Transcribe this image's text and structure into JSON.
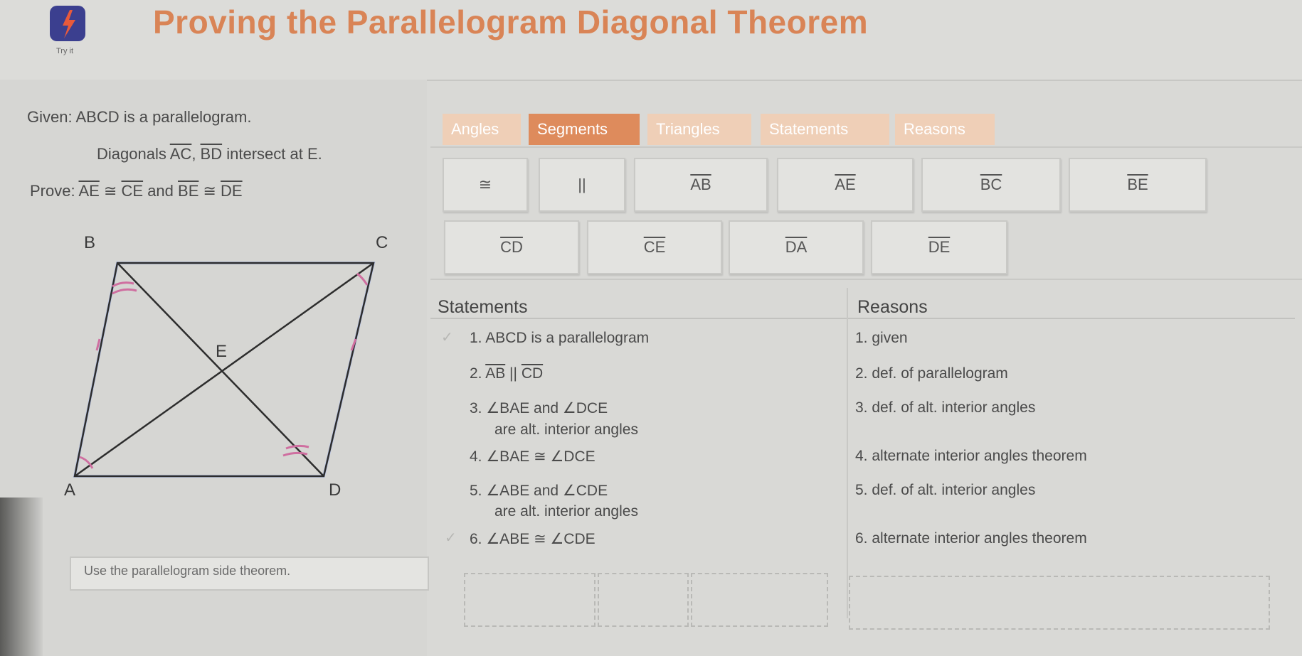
{
  "header": {
    "title": "Proving the Parallelogram Diagonal Theorem",
    "try_it": "Try it"
  },
  "given": {
    "line1": "Given: ABCD is a parallelogram.",
    "line2_prefix": "Diagonals ",
    "seg_ac": "AC",
    "comma": ", ",
    "seg_bd": "BD",
    "line2_suffix": " intersect at E.",
    "prove_prefix": "Prove: ",
    "seg_ae": "AE",
    "cong1": " ≅ ",
    "seg_ce": "CE",
    "and": " and ",
    "seg_be": "BE",
    "cong2": " ≅ ",
    "seg_de": "DE"
  },
  "diagram": {
    "labels": {
      "a": "A",
      "b": "B",
      "c": "C",
      "d": "D",
      "e": "E"
    }
  },
  "tabs": [
    "Angles",
    "Segments",
    "Triangles",
    "Statements",
    "Reasons"
  ],
  "active_tab": "Segments",
  "tiles": [
    "≅",
    "||",
    "AB",
    "AE",
    "BC",
    "BE",
    "CD",
    "CE",
    "DA",
    "DE"
  ],
  "proof": {
    "statements_header": "Statements",
    "reasons_header": "Reasons",
    "rows": [
      {
        "num": "1.",
        "statement": "ABCD is a parallelogram",
        "reason": "1. given"
      },
      {
        "num": "2.",
        "seg1": "AB",
        "sym": " || ",
        "seg2": "CD",
        "reason": "2. def. of parallelogram"
      },
      {
        "num": "3.",
        "statement": "∠BAE and ∠DCE",
        "statement2": "are alt. interior angles",
        "reason": "3. def. of alt. interior angles"
      },
      {
        "num": "4.",
        "statement": "∠BAE ≅ ∠DCE",
        "reason": "4. alternate interior angles theorem"
      },
      {
        "num": "5.",
        "statement": "∠ABE and ∠CDE",
        "statement2": "are alt. interior angles",
        "reason": "5. def. of alt. interior angles"
      },
      {
        "num": "6.",
        "statement": "∠ABE ≅ ∠CDE",
        "reason": "6. alternate interior angles theorem"
      }
    ]
  },
  "hint": "Use the parallelogram side theorem."
}
